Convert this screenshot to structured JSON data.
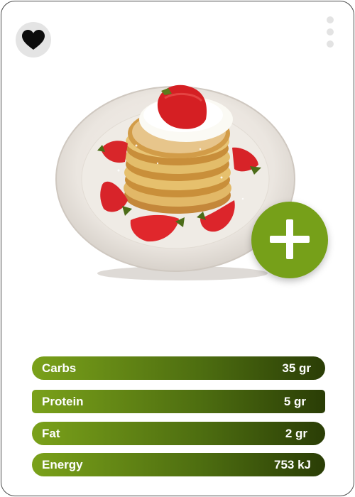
{
  "card": {
    "favorite_icon": "heart-icon",
    "more_icon": "more-vertical-icon",
    "add_icon": "plus-icon",
    "photo": "pancake-stack-with-strawberries",
    "title": "",
    "subtitle": ""
  },
  "nutrition": [
    {
      "label": "Carbs",
      "value": "35 gr"
    },
    {
      "label": "Protein",
      "value": "5 gr"
    },
    {
      "label": "Fat",
      "value": "2 gr"
    },
    {
      "label": "Energy",
      "value": "753 kJ"
    }
  ],
  "colors": {
    "accent_green": "#76a019",
    "bar_dark": "#2a3d06",
    "icon_bg": "#e4e4e4",
    "border": "#4a4a4a"
  }
}
